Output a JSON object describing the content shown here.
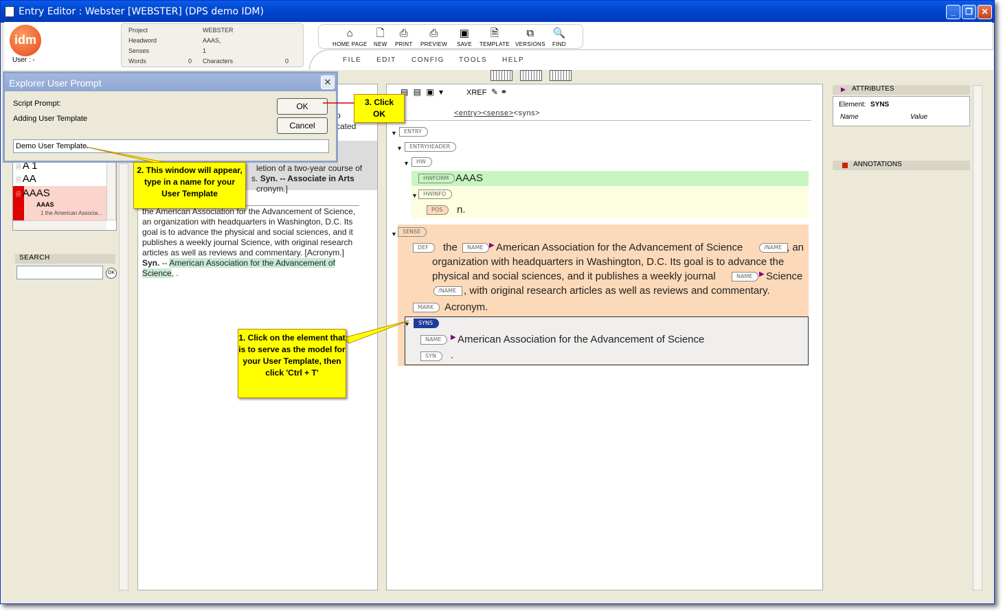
{
  "window": {
    "title": "Entry Editor : Webster [WEBSTER] (DPS demo IDM)",
    "logo": "idm",
    "user_label": "User : -"
  },
  "info": {
    "project_label": "Project",
    "project_value": "WEBSTER",
    "headword_label": "Headword",
    "headword_value": "AAAS,",
    "senses_label": "Senses",
    "senses_value": "1",
    "words_label": "Words",
    "words_value": "0",
    "characters_label": "Characters",
    "characters_value": "0"
  },
  "toolbar": {
    "home": "HOME PAGE",
    "new": "NEW",
    "print": "PRINT",
    "preview": "PREVIEW",
    "save": "SAVE",
    "template": "TEMPLATE",
    "versions": "VERSIONS",
    "find": "FIND"
  },
  "menu": {
    "file": "FILE",
    "edit": "EDIT",
    "config": "CONFIG",
    "tools": "TOOLS",
    "help": "HELP"
  },
  "dialog": {
    "title": "Explorer User Prompt",
    "script_prompt": "Script Prompt:",
    "message": "Adding User Template",
    "ok": "OK",
    "cancel": "Cancel",
    "input_value": "Demo User Template."
  },
  "entry_list": {
    "items": [
      "A 1",
      "AA",
      "AAAS"
    ],
    "sub_head": "AAAS",
    "sub_text": "1 the American Associa..."
  },
  "search": {
    "label": "SEARCH",
    "ok": "OK"
  },
  "preview": {
    "frag1": "p",
    "frag2": "cated",
    "line_a": "letion of a two-year course of",
    "line_b_pre": "s.",
    "line_b_syn": "Syn.",
    "line_b_post": "-- Associate in Arts",
    "line_c": "cronym.]",
    "para": [
      "the American Association for the Advancement of Science,",
      "an organization with headquarters in Washington, D.C. Its",
      "goal is to advance the physical and social sciences, and it",
      "publishes a weekly journal Science, with original research",
      "articles as well as reviews and commentary. [Acronym.]"
    ],
    "syn_label": "Syn.",
    "syn_dash": "--",
    "syn_hl1": "American Association for the Advancement of",
    "syn_hl2": "Science",
    ", ": "",
    "syn_end": ", ."
  },
  "editor": {
    "xref": "XREF",
    "breadcrumb": [
      "<entry>",
      "<sense>",
      "<syns>"
    ],
    "tags": {
      "entry": "ENTRY",
      "entryheader": "ENTRYHEADER",
      "hw": "HW",
      "hwform": "HWFORM",
      "hwinfo": "HWINFO",
      "pos": "POS",
      "sense": "SENSE",
      "def": "DEF",
      "name": "NAME",
      "name_end": "/NAME",
      "mark": "MARK",
      "syns": "SYNS",
      "syn": "SYN"
    },
    "hwform_text": "AAAS",
    "pos_text": "n.",
    "def_the": "the",
    "def_name": "American Association for the Advancement of Science",
    "def_after": ", an",
    "def_line2": "organization with headquarters in Washington, D.C. Its goal is to advance the",
    "def_line3a": "physical and social sciences, and it publishes a weekly journal",
    "def_line3b": "Science",
    "def_line4": ", with original research articles as well as reviews and commentary.",
    "mark_text": "Acronym.",
    "syns_name": "American Association for the Advancement of Science",
    "syn_text": "."
  },
  "attributes": {
    "title": "ATTRIBUTES",
    "element_label": "Element:",
    "element_value": "SYNS",
    "col_name": "Name",
    "col_value": "Value",
    "annotations": "ANNOTATIONS"
  },
  "callouts": {
    "c1": "1. Click on the element that is to serve as the model for your User Template, then click 'Ctrl + T'",
    "c2": "2. This window will appear, type in a name for your User Template",
    "c3": "3. Click OK"
  },
  "colors": {
    "titlebar": "#0047cf",
    "hwform_bg": "#c8f5c0",
    "hwinfo_bg": "#fdfde0",
    "sense_bg": "#fcd9b8",
    "callout": "#ffff00",
    "selected_red": "#e00000"
  }
}
